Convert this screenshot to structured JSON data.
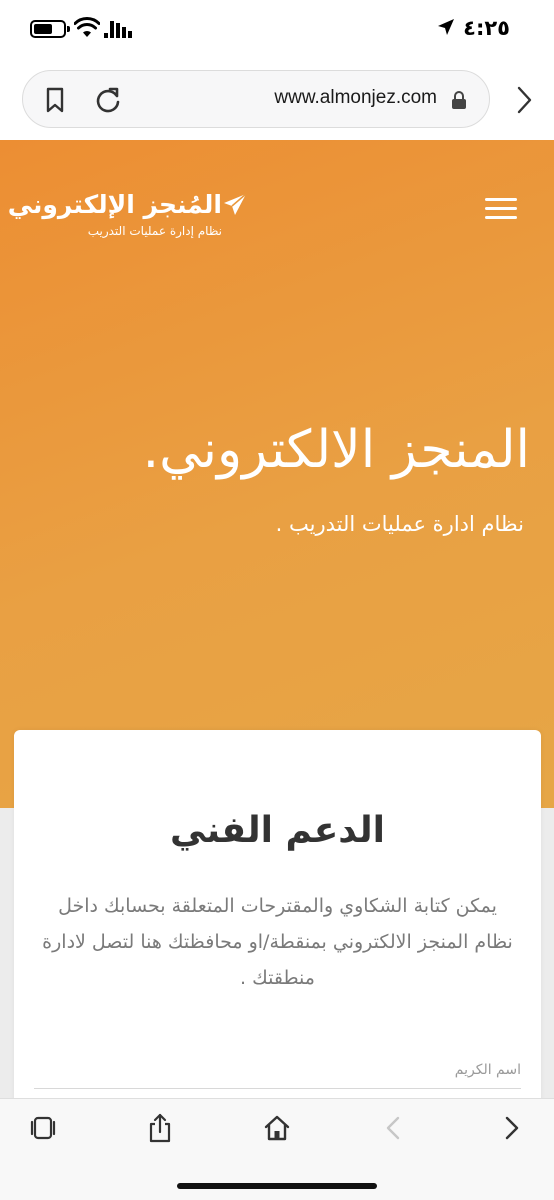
{
  "status_bar": {
    "time": "٤:٢٥",
    "icons": [
      "location-arrow-icon",
      "battery-icon",
      "wifi-icon",
      "cellular-signal-icon"
    ]
  },
  "browser": {
    "url": "www.almonjez.com",
    "icons": [
      "bookmark-icon",
      "reload-icon",
      "lock-icon",
      "forward-chevron-icon"
    ]
  },
  "site": {
    "logo_main": "المُنجز الإلكتروني",
    "logo_sub": "نظام إدارة عمليات التدريب",
    "logo_icon": "paper-plane-icon",
    "menu_icon": "hamburger-menu-icon",
    "hero_title": "المنجز الالكتروني.",
    "hero_subtitle": "نظام ادارة عمليات التدريب ."
  },
  "support_card": {
    "title": "الدعم الفني",
    "description": "يمكن كتابة الشكاوي والمقترحات المتعلقة بحسابك داخل نظام المنجز الالكتروني بمنقطة/او محافظتك هنا لتصل لادارة منطقتك .",
    "name_label": "اسم الكريم"
  },
  "toolbar": {
    "icons": [
      "tabs-icon",
      "share-icon",
      "home-icon",
      "back-icon",
      "forward-icon"
    ]
  },
  "colors": {
    "hero_start": "#ec8e33",
    "hero_end": "#e6a646",
    "card_title": "#333333",
    "card_text": "#7a7a7a"
  }
}
